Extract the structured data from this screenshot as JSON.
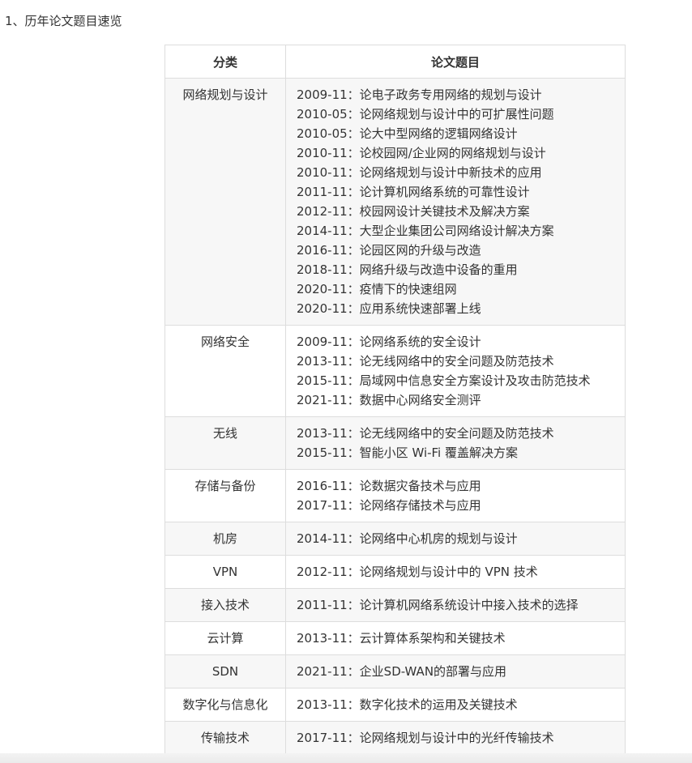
{
  "heading": "1、历年论文题目速览",
  "table": {
    "headers": [
      "分类",
      "论文题目"
    ],
    "rows": [
      {
        "category": "网络规划与设计",
        "topics": [
          "2009-11：论电子政务专用网络的规划与设计",
          "2010-05：论网络规划与设计中的可扩展性问题",
          "2010-05：论大中型网络的逻辑网络设计",
          "2010-11：论校园网/企业网的网络规划与设计",
          "2010-11：论网络规划与设计中新技术的应用",
          "2011-11：论计算机网络系统的可靠性设计",
          "2012-11：校园网设计关键技术及解决方案",
          "2014-11：大型企业集团公司网络设计解决方案",
          "2016-11：论园区网的升级与改造",
          "2018-11：网络升级与改造中设备的重用",
          "2020-11：疫情下的快速组网",
          "2020-11：应用系统快速部署上线"
        ]
      },
      {
        "category": "网络安全",
        "topics": [
          "2009-11：论网络系统的安全设计",
          "2013-11：论无线网络中的安全问题及防范技术",
          "2015-11：局域网中信息安全方案设计及攻击防范技术",
          "2021-11：数据中心网络安全测评"
        ]
      },
      {
        "category": "无线",
        "topics": [
          "2013-11：论无线网络中的安全问题及防范技术",
          "2015-11：智能小区 Wi-Fi 覆盖解决方案"
        ]
      },
      {
        "category": "存储与备份",
        "topics": [
          "2016-11：论数据灾备技术与应用",
          "2017-11：论网络存储技术与应用"
        ]
      },
      {
        "category": "机房",
        "topics": [
          "2014-11：论网络中心机房的规划与设计"
        ]
      },
      {
        "category": "VPN",
        "topics": [
          "2012-11：论网络规划与设计中的 VPN 技术"
        ]
      },
      {
        "category": "接入技术",
        "topics": [
          "2011-11：论计算机网络系统设计中接入技术的选择"
        ]
      },
      {
        "category": "云计算",
        "topics": [
          "2013-11：云计算体系架构和关键技术"
        ]
      },
      {
        "category": "SDN",
        "topics": [
          "2021-11：企业SD-WAN的部署与应用"
        ]
      },
      {
        "category": "数字化与信息化",
        "topics": [
          "2013-11：数字化技术的运用及关键技术"
        ]
      },
      {
        "category": "传输技术",
        "topics": [
          "2017-11：论网络规划与设计中的光纤传输技术"
        ]
      }
    ]
  }
}
